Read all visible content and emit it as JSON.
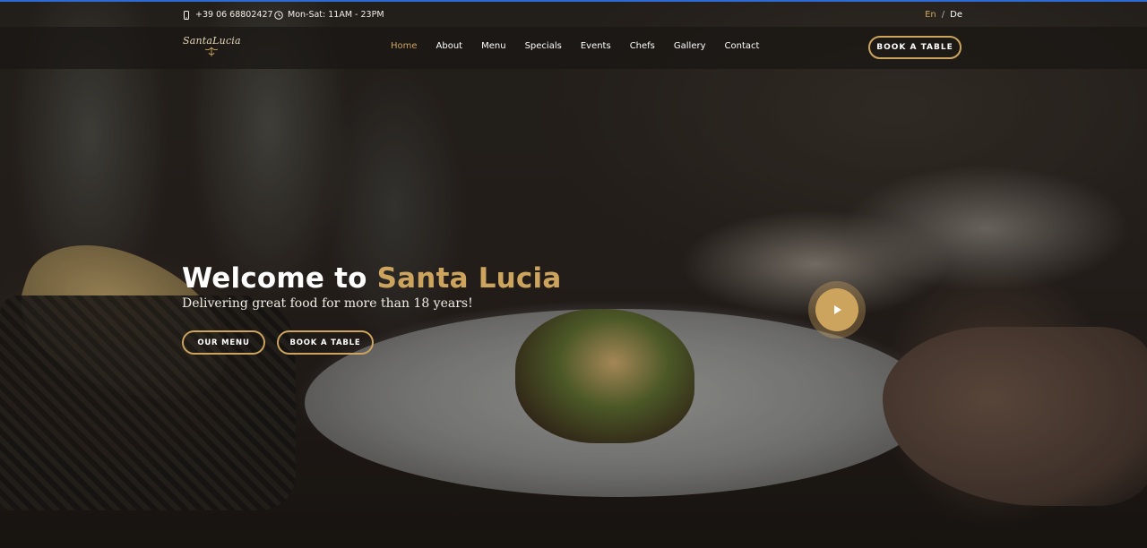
{
  "topbar": {
    "phone": "+39 06 68802427",
    "hours": "Mon-Sat: 11AM - 23PM",
    "phone_icon": "phone-icon",
    "clock_icon": "clock-icon",
    "lang_en": "En",
    "lang_sep": "/",
    "lang_de": "De"
  },
  "header": {
    "logo": "SantaLucia",
    "nav": [
      {
        "label": "Home",
        "active": true
      },
      {
        "label": "About"
      },
      {
        "label": "Menu"
      },
      {
        "label": "Specials"
      },
      {
        "label": "Events"
      },
      {
        "label": "Chefs"
      },
      {
        "label": "Gallery"
      },
      {
        "label": "Contact"
      }
    ],
    "book_button": "BOOK A TABLE"
  },
  "hero": {
    "title_prefix": "Welcome to ",
    "title_accent": "Santa Lucia",
    "subtitle": "Delivering great food for more than 18 years!",
    "menu_button": "OUR MENU",
    "book_button": "BOOK A TABLE",
    "play_icon": "play-icon"
  },
  "colors": {
    "accent": "#cda45e",
    "header_bg": "rgba(25,22,20,0.72)"
  }
}
